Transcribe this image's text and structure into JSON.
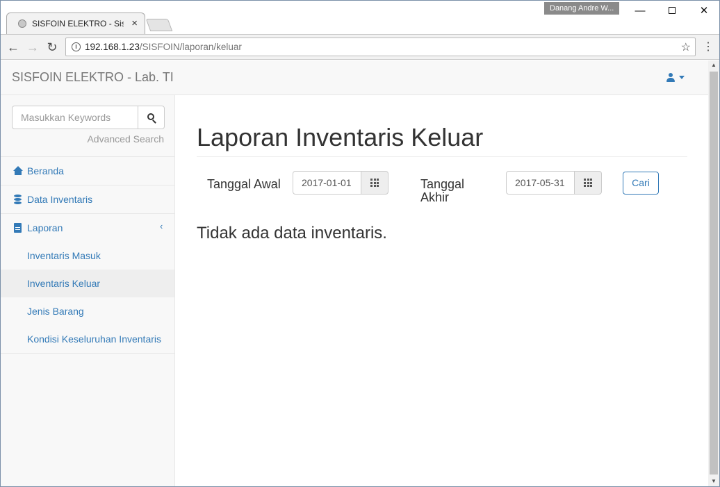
{
  "browser": {
    "tab_title": "SISFOIN ELEKTRO - Sistem",
    "tab_close": "×",
    "profile_name": "Danang Andre W...",
    "url_host": "192.168.1.23",
    "url_path": "/SISFOIN/laporan/keluar",
    "info_icon": "i",
    "star_icon": "☆",
    "menu_icon": "⋮",
    "back_icon": "←",
    "forward_icon": "→",
    "reload_icon": "↻",
    "minimize_icon": "—",
    "close_icon": "✕"
  },
  "navbar": {
    "brand": "SISFOIN ELEKTRO - Lab. TI"
  },
  "sidebar": {
    "search_placeholder": "Masukkan Keywords",
    "advanced_search": "Advanced Search",
    "items": [
      {
        "label": "Beranda",
        "icon": "home-icon"
      },
      {
        "label": "Data Inventaris",
        "icon": "database-icon"
      },
      {
        "label": "Laporan",
        "icon": "file-icon"
      }
    ],
    "laporan_chevron": "‹",
    "subitems": [
      {
        "label": "Inventaris Masuk",
        "active": false
      },
      {
        "label": "Inventaris Keluar",
        "active": true
      },
      {
        "label": "Jenis Barang",
        "active": false
      },
      {
        "label": "Kondisi Keseluruhan Inventaris",
        "active": false
      }
    ]
  },
  "main": {
    "title": "Laporan Inventaris Keluar",
    "start_label": "Tanggal Awal",
    "start_value": "2017-01-01",
    "end_label_line1": "Tanggal",
    "end_label_line2": "Akhir",
    "end_value": "2017-05-31",
    "search_button": "Cari",
    "empty_message": "Tidak ada data inventaris."
  },
  "colors": {
    "link": "#337ab7",
    "navbar_bg": "#f8f8f8",
    "active_bg": "#eeeeee"
  }
}
